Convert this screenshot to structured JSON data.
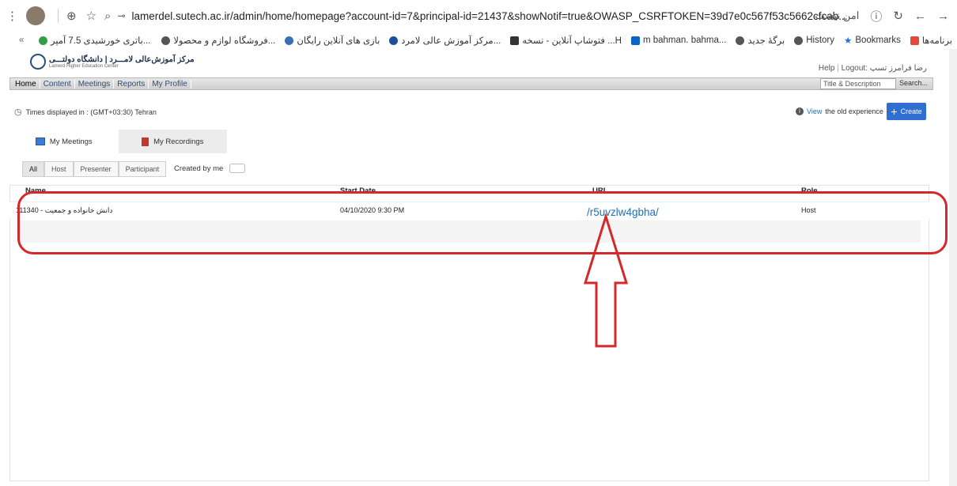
{
  "browser": {
    "url": "lamerdel.sutech.ac.ir/admin/home/homepage?account-id=7&principal-id=21437&showNotif=true&OWASP_CSRFTOKEN=39d7e0c567f53c5662cfcab...",
    "security_label": "امن نیست",
    "bookmarks": [
      {
        "label": "برنامه‌ها"
      },
      {
        "label": "Bookmarks"
      },
      {
        "label": "History"
      },
      {
        "label": "برگهٔ جدید"
      },
      {
        "label": "m bahman. bahma..."
      },
      {
        "label": "فتوشاپ آنلاین - نسخه ...H"
      },
      {
        "label": "مرکز آموزش عالی لامرد..."
      },
      {
        "label": "بازی های آنلاین رایگان"
      },
      {
        "label": "فروشگاه لوازم و محصولا..."
      },
      {
        "label": "باتری خورشیدی 7.5 آمپر..."
      }
    ]
  },
  "header": {
    "logo_title": "مرکز آموزش‌عالی لامـــرد | دانشگاه دولتـــی",
    "logo_sub": "Lamerd Higher Education Center",
    "help": "Help",
    "logout": "Logout: رضا فرامرز تسپ",
    "nav": [
      "Home",
      "Content",
      "Meetings",
      "Reports",
      "My Profile"
    ],
    "search_placeholder": "Title & Description",
    "search_btn": "Search..."
  },
  "main": {
    "timezone": "Times displayed in : (GMT+03:30) Tehran",
    "view_link": "View",
    "old_exp": "the old experience",
    "create": "Create",
    "tabs": [
      "My Meetings",
      "My Recordings"
    ],
    "filters": [
      "All",
      "Host",
      "Presenter",
      "Participant"
    ],
    "created_by_me": "Created by me",
    "columns": [
      "Name",
      "Start Date",
      "URL",
      "Role"
    ],
    "rows": [
      {
        "name": "دانش خانواده و جمعیت - 111340",
        "start": "04/10/2020 9:30 PM",
        "url": "/r5uvzlw4gbha/",
        "role": "Host"
      }
    ]
  },
  "colors": {
    "accent": "#2f6fd1",
    "highlight": "#d4282b",
    "link": "#1d6fb8"
  }
}
